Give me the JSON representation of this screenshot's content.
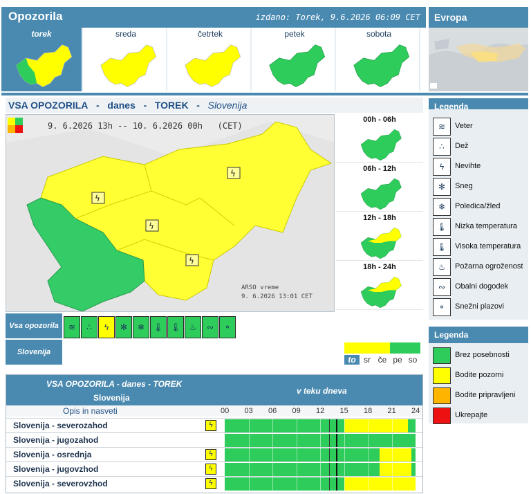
{
  "header": {
    "title": "Opozorila",
    "issued": "izdano: Torek, 9.6.2026 06:09 CET",
    "europe": "Evropa"
  },
  "days": [
    {
      "label": "torek",
      "active": true,
      "fill": "mixed-green"
    },
    {
      "label": "sreda",
      "active": false,
      "fill": "yellow"
    },
    {
      "label": "četrtek",
      "active": false,
      "fill": "yellow"
    },
    {
      "label": "petek",
      "active": false,
      "fill": "green"
    },
    {
      "label": "sobota",
      "active": false,
      "fill": "green"
    }
  ],
  "main": {
    "heading_all": "VSA OPOZORILA",
    "heading_today": "danes",
    "heading_day": "TOREK",
    "heading_region": "Slovenija",
    "period": "9. 6.2026 13h -- 10. 6.2026 00h   (CET)",
    "stamp_line1": "ARSO vreme",
    "stamp_line2": "9. 6.2026  13:01 CET"
  },
  "submaps": [
    {
      "label": "00h - 06h",
      "fill": "green"
    },
    {
      "label": "06h - 12h",
      "fill": "green"
    },
    {
      "label": "12h - 18h",
      "fill": "yellow-green"
    },
    {
      "label": "18h - 24h",
      "fill": "yellow-green"
    }
  ],
  "event_row": {
    "label": "Vsa opozorila",
    "icons": [
      {
        "name": "wind-icon",
        "glyph": "≋",
        "state": "g"
      },
      {
        "name": "rain-icon",
        "glyph": "∴",
        "state": "g"
      },
      {
        "name": "thunderstorm-icon",
        "glyph": "ϟ",
        "state": "on"
      },
      {
        "name": "snow-icon",
        "glyph": "✻",
        "state": "g"
      },
      {
        "name": "ice-icon",
        "glyph": "❄",
        "state": "g"
      },
      {
        "name": "low-temp-icon",
        "glyph": "🌡",
        "state": "g"
      },
      {
        "name": "high-temp-icon",
        "glyph": "🌡",
        "state": "g"
      },
      {
        "name": "fire-icon",
        "glyph": "♨",
        "state": "g"
      },
      {
        "name": "coastal-icon",
        "glyph": "∾",
        "state": "g"
      },
      {
        "name": "avalanche-icon",
        "glyph": "⚬",
        "state": "g"
      }
    ]
  },
  "region_row": {
    "label": "Slovenija",
    "days": [
      "to",
      "sr",
      "če",
      "pe",
      "so"
    ],
    "day_levels": [
      "yellow",
      "yellow",
      "yellow",
      "green",
      "green"
    ]
  },
  "timeline": {
    "title": "VSA OPOZORILA - danes - TOREK",
    "region": "Slovenija",
    "during_day": "v teku dneva",
    "description": "Opis in nasveti",
    "hours": [
      "00",
      "03",
      "06",
      "09",
      "12",
      "15",
      "18",
      "21",
      "24"
    ],
    "rows": [
      {
        "name": "Slovenija - severozahod",
        "icon": true,
        "yellow_from": 15,
        "yellow_to": 23
      },
      {
        "name": "Slovenija - jugozahod",
        "icon": false,
        "yellow_from": null,
        "yellow_to": null
      },
      {
        "name": "Slovenija - osrednja",
        "icon": true,
        "yellow_from": 19.5,
        "yellow_to": 23.5
      },
      {
        "name": "Slovenija - jugovzhod",
        "icon": true,
        "yellow_from": 19.5,
        "yellow_to": 23.5
      },
      {
        "name": "Slovenija - severovzhod",
        "icon": true,
        "yellow_from": 15,
        "yellow_to": 24
      }
    ],
    "now_hour": 14
  },
  "legend": {
    "title": "Legenda",
    "items": [
      "Veter",
      "Dež",
      "Nevihte",
      "Sneg",
      "Poledica/žled",
      "Nizka temperatura",
      "Visoka temperatura",
      "Požarna ogroženost",
      "Obalni dogodek",
      "Snežni plazovi"
    ],
    "item_glyphs": [
      "≋",
      "∴",
      "ϟ",
      "✻",
      "❄",
      "🌡",
      "🌡",
      "♨",
      "∾",
      "⚬"
    ],
    "title2": "Legenda",
    "levels": [
      {
        "label": "Brez posebnosti",
        "color": "#2ecc5a"
      },
      {
        "label": "Bodite pozorni",
        "color": "#ffff00"
      },
      {
        "label": "Bodite pripravljeni",
        "color": "#ffb400"
      },
      {
        "label": "Ukrepajte",
        "color": "#ee1111"
      }
    ]
  },
  "colors": {
    "green": "#2ecc5a",
    "yellow": "#ffff00",
    "header": "#4a8ab0"
  }
}
